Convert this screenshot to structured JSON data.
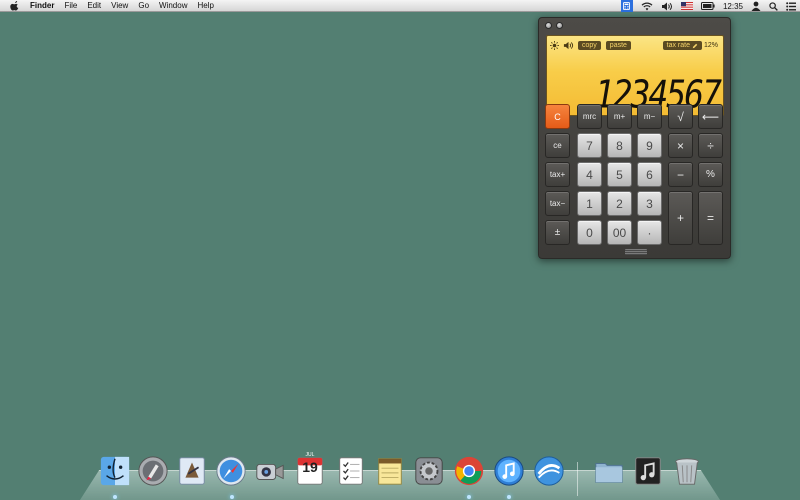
{
  "menubar": {
    "app_name": "Finder",
    "menus": [
      "File",
      "Edit",
      "View",
      "Go",
      "Window",
      "Help"
    ],
    "clock": "12:35",
    "status_icons": [
      "calculator-icon",
      "wifi-icon",
      "volume-icon",
      "us-flag-icon",
      "battery-icon",
      "user-icon",
      "spotlight-icon",
      "notification-center-icon"
    ]
  },
  "calculator": {
    "display_value": "1234567",
    "copy_label": "copy",
    "paste_label": "paste",
    "tax_rate_label": "tax rate",
    "tax_rate_value": "12%",
    "keys": {
      "clear": "C",
      "mrc": "mrc",
      "m_plus": "m+",
      "m_minus": "m−",
      "sqrt": "√",
      "backspace": "⟵",
      "ce": "ce",
      "seven": "7",
      "eight": "8",
      "nine": "9",
      "multiply": "×",
      "divide": "÷",
      "tax_plus": "tax+",
      "four": "4",
      "five": "5",
      "six": "6",
      "minus": "−",
      "percent": "%",
      "tax_minus": "tax−",
      "one": "1",
      "two": "2",
      "three": "3",
      "plus": "+",
      "equals": "=",
      "plus_minus": "±",
      "zero": "0",
      "double_zero": "00",
      "decimal": "·"
    },
    "colors": {
      "lcd": "#f8cd49",
      "clear_key": "#e55b18"
    }
  },
  "calendar_icon": {
    "month": "JUL",
    "day": "19"
  },
  "dock": {
    "apps": [
      "finder-icon",
      "launchpad-icon",
      "mail-icon",
      "safari-icon",
      "facetime-icon",
      "calendar-icon",
      "reminders-icon",
      "notes-icon",
      "system-preferences-icon",
      "chrome-icon",
      "itunes-icon",
      "openoffice-icon",
      "downloads-folder-icon",
      "itunes-stack-icon",
      "trash-icon"
    ]
  },
  "background_color": "#537f72"
}
